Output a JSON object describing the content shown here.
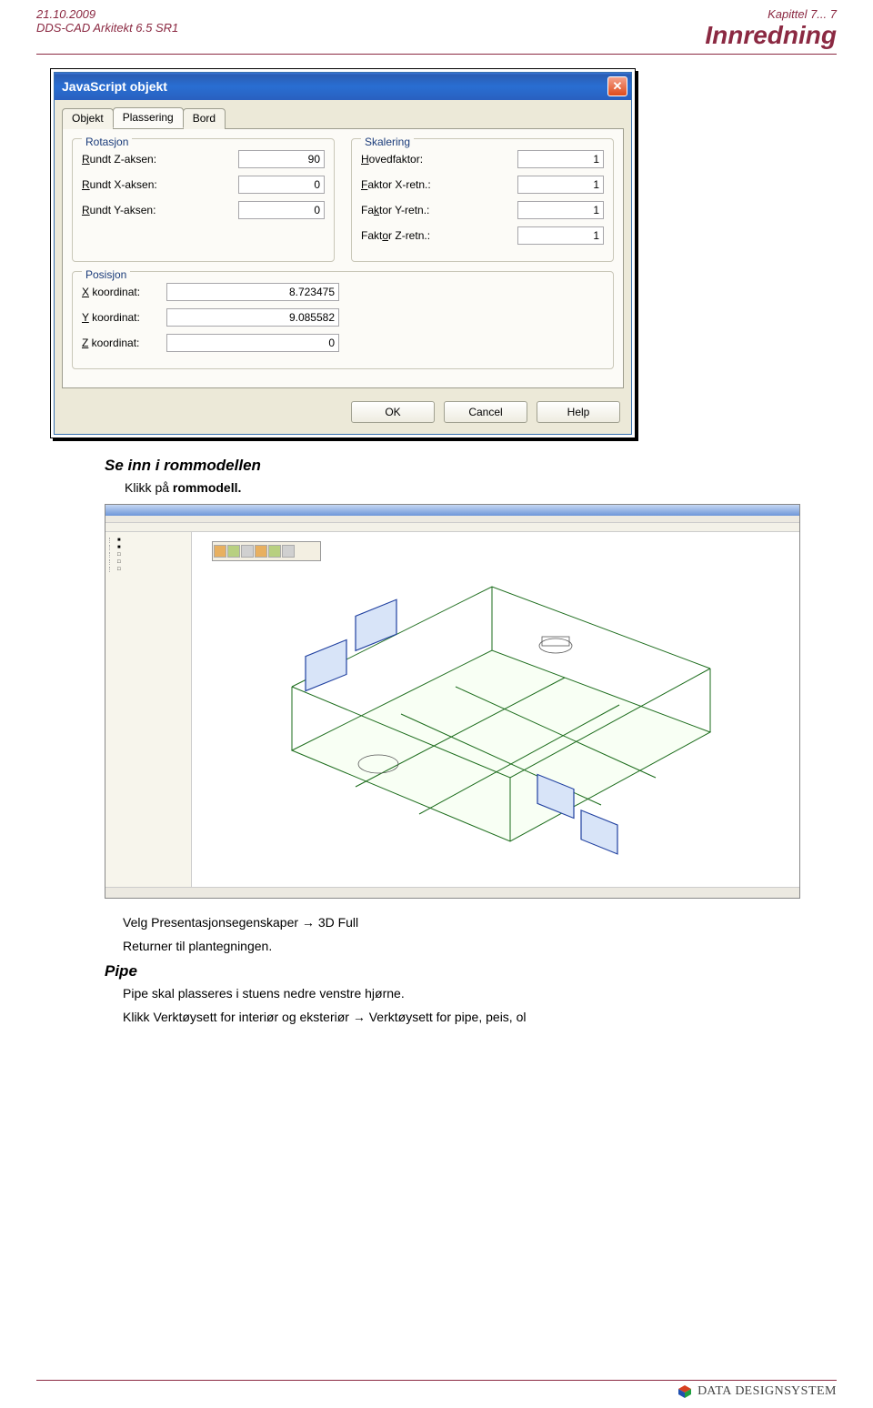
{
  "header": {
    "date": "21.10.2009",
    "app": "DDS-CAD Arkitekt 6.5 SR1",
    "chapter": "Kapittel 7... 7",
    "title": "Innredning"
  },
  "dialog": {
    "title": "JavaScript objekt",
    "close": "✕",
    "tabs": {
      "t1": "Objekt",
      "t2": "Plassering",
      "t3": "Bord"
    },
    "rotation": {
      "legend": "Rotasjon",
      "z_label": "Rundt Z-aksen:",
      "z_val": "90",
      "x_label": "Rundt X-aksen:",
      "x_val": "0",
      "y_label": "Rundt Y-aksen:",
      "y_val": "0"
    },
    "scaling": {
      "legend": "Skalering",
      "main_label": "Hovedfaktor:",
      "main_val": "1",
      "fx_label": "Faktor X-retn.:",
      "fx_val": "1",
      "fy_label": "Faktor Y-retn.:",
      "fy_val": "1",
      "fz_label": "Faktor Z-retn.:",
      "fz_val": "1"
    },
    "position": {
      "legend": "Posisjon",
      "x_label": "X koordinat:",
      "x_val": "8.723475",
      "y_label": "Y koordinat:",
      "y_val": "9.085582",
      "z_label": "Z koordinat:",
      "z_val": "0"
    },
    "buttons": {
      "ok": "OK",
      "cancel": "Cancel",
      "help": "Help"
    }
  },
  "body": {
    "h1": "Se inn i rommodellen",
    "p1a": "Klikk på ",
    "p1b": "rommodell.",
    "instr1a": "Velg ",
    "instr1b": "Presentasjonsegenskaper",
    "instr1c": " → ",
    "instr1d": "3D Full",
    "instr2a": "Returner til ",
    "instr2b": "plantegningen.",
    "h2": "Pipe",
    "p3": "Pipe skal plasseres i stuens nedre venstre hjørne.",
    "p4a": "Klikk ",
    "p4b": "Verktøysett for interiør og eksteriør",
    "p4c": " → ",
    "p4d": "Verktøysett for pipe, peis, ol"
  },
  "footer": {
    "brand_prefix": "D",
    "brand1": "ATA",
    "brand_mid": " D",
    "brand2": "ESIGN",
    "brand_suf": "S",
    "brand3": "YSTEM"
  }
}
